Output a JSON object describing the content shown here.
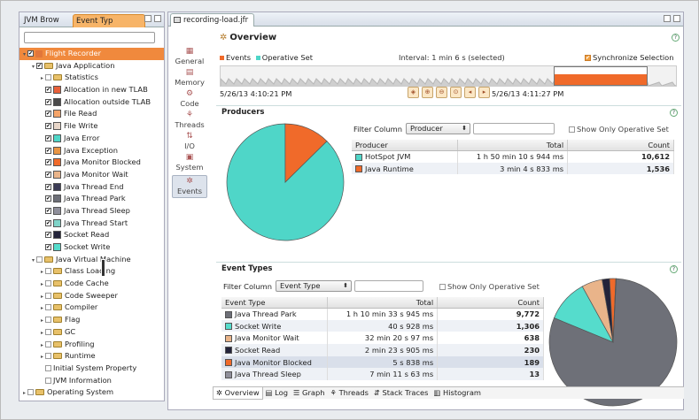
{
  "left_panel": {
    "tabs": [
      {
        "label": "JVM Brow"
      },
      {
        "label": "Event Typ"
      }
    ],
    "tree": [
      {
        "label": "Flight Recorder",
        "level": 0,
        "expanded": true,
        "checked": true,
        "icon": "flag-icon",
        "selected": true
      },
      {
        "label": "Java Application",
        "level": 1,
        "expanded": true,
        "checked": true,
        "icon": "folder-icon"
      },
      {
        "label": "Statistics",
        "level": 2,
        "expanded": false,
        "checked": false,
        "icon": "folder-icon"
      },
      {
        "label": "Allocation in new TLAB",
        "level": 2,
        "checked": true,
        "swatch": "#e8603a"
      },
      {
        "label": "Allocation outside TLAB",
        "level": 2,
        "checked": true,
        "swatch": "#4a4a4a"
      },
      {
        "label": "File Read",
        "level": 2,
        "checked": true,
        "swatch": "#f5a469"
      },
      {
        "label": "File Write",
        "level": 2,
        "checked": true,
        "swatch": "#e8d6c9"
      },
      {
        "label": "Java Error",
        "level": 2,
        "checked": true,
        "swatch": "#4fd6c8"
      },
      {
        "label": "Java Exception",
        "level": 2,
        "checked": true,
        "swatch": "#e89544"
      },
      {
        "label": "Java Monitor Blocked",
        "level": 2,
        "checked": true,
        "swatch": "#f06a2a"
      },
      {
        "label": "Java Monitor Wait",
        "level": 2,
        "checked": true,
        "swatch": "#e9b48a"
      },
      {
        "label": "Java Thread End",
        "level": 2,
        "checked": true,
        "swatch": "#3b3b55"
      },
      {
        "label": "Java Thread Park",
        "level": 2,
        "checked": true,
        "swatch": "#6e7078"
      },
      {
        "label": "Java Thread Sleep",
        "level": 2,
        "checked": true,
        "swatch": "#8f8f9b"
      },
      {
        "label": "Java Thread Start",
        "level": 2,
        "checked": true,
        "swatch": "#7fd3c8"
      },
      {
        "label": "Socket Read",
        "level": 2,
        "checked": true,
        "swatch": "#23233a"
      },
      {
        "label": "Socket Write",
        "level": 2,
        "checked": true,
        "swatch": "#55dccc"
      },
      {
        "label": "Java Virtual Machine",
        "level": 1,
        "expanded": true,
        "checked": false,
        "icon": "folder-icon"
      },
      {
        "label": "Class Loading",
        "level": 2,
        "expanded": false,
        "checked": false,
        "icon": "folder-icon"
      },
      {
        "label": "Code Cache",
        "level": 2,
        "expanded": false,
        "checked": false,
        "icon": "folder-icon"
      },
      {
        "label": "Code Sweeper",
        "level": 2,
        "expanded": false,
        "checked": false,
        "icon": "folder-icon"
      },
      {
        "label": "Compiler",
        "level": 2,
        "expanded": false,
        "checked": false,
        "icon": "folder-icon"
      },
      {
        "label": "Flag",
        "level": 2,
        "expanded": false,
        "checked": false,
        "icon": "folder-icon"
      },
      {
        "label": "GC",
        "level": 2,
        "expanded": false,
        "checked": false,
        "icon": "folder-icon"
      },
      {
        "label": "Profiling",
        "level": 2,
        "expanded": false,
        "checked": false,
        "icon": "folder-icon"
      },
      {
        "label": "Runtime",
        "level": 2,
        "expanded": false,
        "checked": false,
        "icon": "folder-icon"
      },
      {
        "label": "Initial System Property",
        "level": 2,
        "checked": false,
        "swatch": null
      },
      {
        "label": "JVM Information",
        "level": 2,
        "checked": false,
        "swatch": null
      },
      {
        "label": "Operating System",
        "level": 0,
        "expanded": false,
        "checked": false,
        "icon": "folder-icon"
      }
    ]
  },
  "editor": {
    "tab_label": "recording-load.jfr",
    "nav": [
      {
        "label": "General",
        "icon": "general-icon"
      },
      {
        "label": "Memory",
        "icon": "memory-icon"
      },
      {
        "label": "Code",
        "icon": "code-icon"
      },
      {
        "label": "Threads",
        "icon": "threads-icon"
      },
      {
        "label": "I/O",
        "icon": "io-icon"
      },
      {
        "label": "System",
        "icon": "system-icon"
      },
      {
        "label": "Events",
        "icon": "events-icon",
        "selected": true
      }
    ],
    "overview_title": "Overview",
    "help_glyph": "?",
    "legend": {
      "events": "Events",
      "operative": "Operative Set",
      "events_color": "#f06a2a",
      "operative_color": "#4fd6c8"
    },
    "interval": "Interval: 1 min 6 s (selected)",
    "sync_label": "Synchronize Selection",
    "start_time": "5/26/13 4:10:21 PM",
    "end_time": "5/26/13 4:11:27 PM",
    "producers": {
      "title": "Producers",
      "filter_label": "Filter Column",
      "filter_value": "Producer",
      "show_operative": "Show Only Operative Set",
      "columns": [
        "Producer",
        "Total",
        "Count"
      ],
      "rows": [
        {
          "name": "HotSpot JVM",
          "total": "1 h 50 min 10 s 944 ms",
          "count": "10,612",
          "color": "#4fd6c8"
        },
        {
          "name": "Java Runtime",
          "total": "3 min 4 s 833 ms",
          "count": "1,536",
          "color": "#f06a2a"
        }
      ]
    },
    "event_types": {
      "title": "Event Types",
      "filter_label": "Filter Column",
      "filter_value": "Event Type",
      "show_operative": "Show Only Operative Set",
      "columns": [
        "Event Type",
        "Total",
        "Count"
      ],
      "rows": [
        {
          "name": "Java Thread Park",
          "total": "1 h 10 min 33 s 945 ms",
          "count": "9,772",
          "color": "#6e7078"
        },
        {
          "name": "Socket Write",
          "total": "40 s 928 ms",
          "count": "1,306",
          "color": "#55dccc"
        },
        {
          "name": "Java Monitor Wait",
          "total": "32 min 20 s 97 ms",
          "count": "638",
          "color": "#e9b48a"
        },
        {
          "name": "Socket Read",
          "total": "2 min 23 s 905 ms",
          "count": "230",
          "color": "#23233a"
        },
        {
          "name": "Java Monitor Blocked",
          "total": "5 s 838 ms",
          "count": "189",
          "color": "#f06a2a"
        },
        {
          "name": "Java Thread Sleep",
          "total": "7 min 11 s 63 ms",
          "count": "13",
          "color": "#8f8f9b"
        }
      ]
    },
    "bottom_tabs": [
      "Overview",
      "Log",
      "Graph",
      "Threads",
      "Stack Traces",
      "Histogram"
    ]
  }
}
